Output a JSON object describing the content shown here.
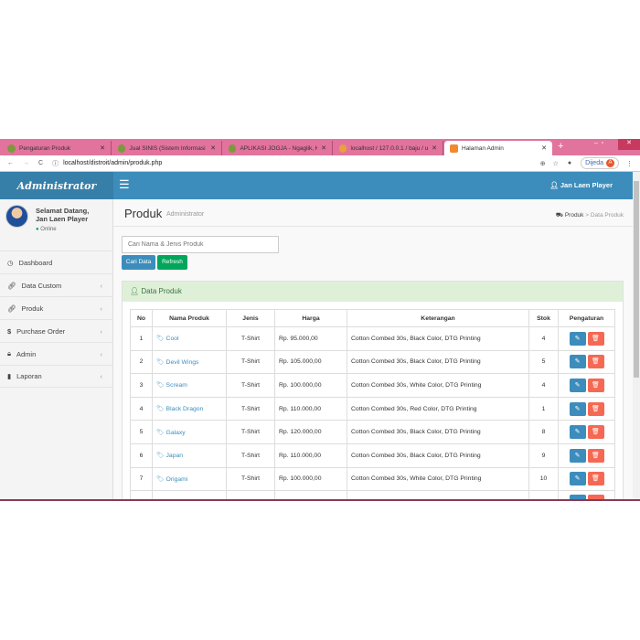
{
  "browser": {
    "tabs": [
      {
        "title": "Pengaturan Produk"
      },
      {
        "title": "Jual SINIS (Sistem Informasi Ni..."
      },
      {
        "title": "APLIKASI JOGJA - Ngaglik, Kab..."
      },
      {
        "title": "localhost / 127.0.0.1 / baju / u..."
      },
      {
        "title": "Halaman Admin"
      }
    ],
    "url": "localhost/distroit/admin/produk.php",
    "profile": "Dijeda",
    "avatar_letter": "A"
  },
  "app": {
    "logo": "Administrator",
    "user_name": "Jan Laen Player"
  },
  "sidebar": {
    "greeting": "Selamat Datang,",
    "user": "Jan Laen Player",
    "status": "Online",
    "items": [
      {
        "label": "Dashboard"
      },
      {
        "label": "Data Custom"
      },
      {
        "label": "Produk"
      },
      {
        "label": "Purchase Order"
      },
      {
        "label": "Admin"
      },
      {
        "label": "Laporan"
      }
    ]
  },
  "page": {
    "title": "Produk",
    "subtitle": "Administrator",
    "breadcrumb": [
      "Produk",
      "Data Produk"
    ],
    "search_placeholder": "Cari Nama & Jenis Produk",
    "search_btn": "Cari Data",
    "refresh_btn": "Refresh",
    "box_title": "Data Produk"
  },
  "table": {
    "headers": [
      "No",
      "Nama Produk",
      "Jenis",
      "Harga",
      "Keterangan",
      "Stok",
      "Pengaturan"
    ],
    "rows": [
      {
        "no": "1",
        "nama": "Cool",
        "jenis": "T-Shirt",
        "harga": "Rp. 95.000,00",
        "ket": "Cotton Combed 30s, Black Color, DTG Printing",
        "stok": "4"
      },
      {
        "no": "2",
        "nama": "Devil Wings",
        "jenis": "T-Shirt",
        "harga": "Rp. 105.000,00",
        "ket": "Cotton Combed 30s, Black Color, DTG Printing",
        "stok": "5"
      },
      {
        "no": "3",
        "nama": "Scream",
        "jenis": "T-Shirt",
        "harga": "Rp. 100.000,00",
        "ket": "Cotton Combed 30s, White Color, DTG Printing",
        "stok": "4"
      },
      {
        "no": "4",
        "nama": "Black Dragon",
        "jenis": "T-Shirt",
        "harga": "Rp. 110.000,00",
        "ket": "Cotton Combed 30s, Red Color, DTG Printing",
        "stok": "1"
      },
      {
        "no": "5",
        "nama": "Galaxy",
        "jenis": "T-Shirt",
        "harga": "Rp. 120.000,00",
        "ket": "Cotton Combed 30s, Black Color, DTG Printing",
        "stok": "8"
      },
      {
        "no": "6",
        "nama": "Japan",
        "jenis": "T-Shirt",
        "harga": "Rp. 110.000,00",
        "ket": "Cotton Combed 30s, Black Color, DTG Printing",
        "stok": "9"
      },
      {
        "no": "7",
        "nama": "Origami",
        "jenis": "T-Shirt",
        "harga": "Rp. 100.000,00",
        "ket": "Cotton Combed 30s, White Color, DTG Printing",
        "stok": "10"
      }
    ]
  }
}
